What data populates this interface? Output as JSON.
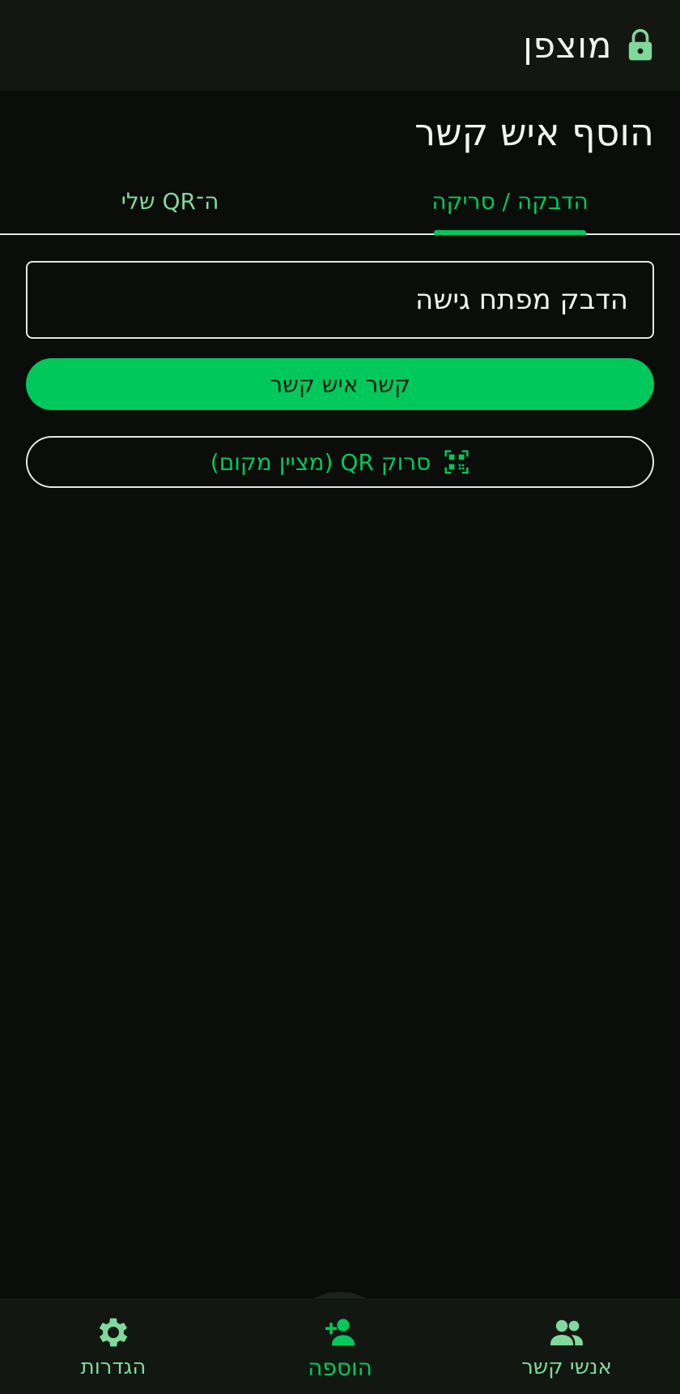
{
  "app": {
    "title": "מוצפן",
    "lock_icon": "lock-icon"
  },
  "page": {
    "title": "הוסף איש קשר"
  },
  "tabs": [
    {
      "label": "הדבקה / סריקה",
      "active": true
    },
    {
      "label": "ה־QR שלי",
      "active": false
    }
  ],
  "form": {
    "access_key_placeholder": "הדבק מפתח גישה",
    "link_button_label": "קשר איש קשר",
    "scan_button_label": "סרוק QR (מציין מקום)",
    "scan_icon": "qr-code-icon"
  },
  "nav": {
    "items": [
      {
        "label": "אנשי קשר",
        "icon": "people-icon"
      },
      {
        "label": "הוספה",
        "icon": "person-add-icon",
        "active": true
      },
      {
        "label": "הגדרות",
        "icon": "gear-icon"
      }
    ]
  },
  "colors": {
    "accent": "#00c85a",
    "accent_light": "#7fd99a",
    "background": "#0a0d0a",
    "bar": "#121712"
  }
}
